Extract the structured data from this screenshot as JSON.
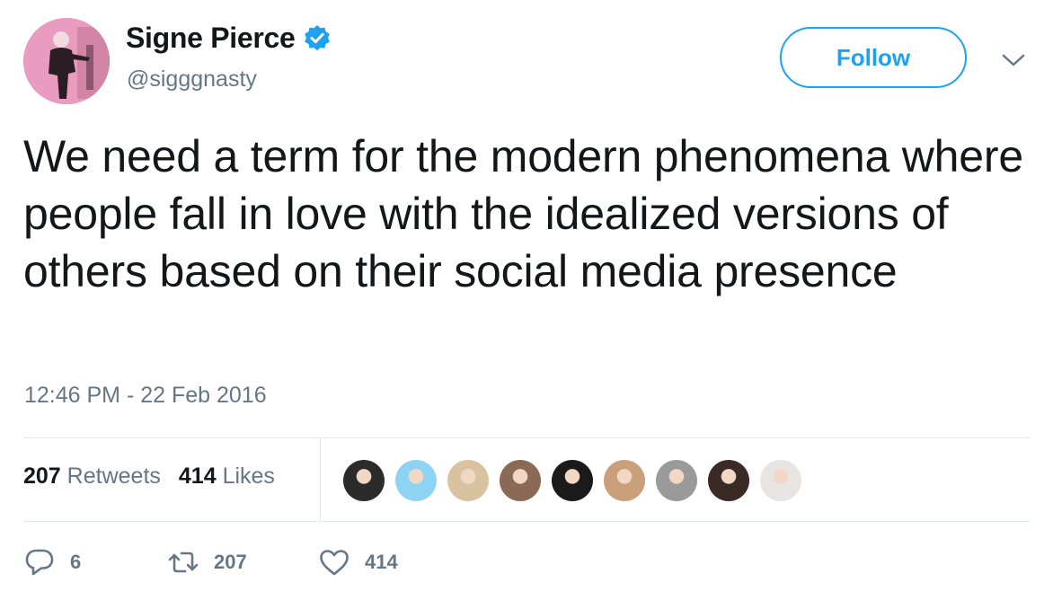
{
  "author": {
    "display_name": "Signe Pierce",
    "handle": "@sigggnasty",
    "verified": true
  },
  "header": {
    "follow_label": "Follow"
  },
  "tweet": {
    "text": "We need a term for the modern phenomena where people fall in love with the idealized versions of others based on their social media presence",
    "timestamp": "12:46 PM - 22 Feb 2016"
  },
  "stats": {
    "retweets_count": "207",
    "retweets_label": "Retweets",
    "likes_count": "414",
    "likes_label": "Likes"
  },
  "likers": [
    {
      "name": "liker-avatar-1",
      "color": "#2b2b2b"
    },
    {
      "name": "liker-avatar-2",
      "color": "#8fd3f4"
    },
    {
      "name": "liker-avatar-3",
      "color": "#d9c2a0"
    },
    {
      "name": "liker-avatar-4",
      "color": "#8a6a55"
    },
    {
      "name": "liker-avatar-5",
      "color": "#1a1a1a"
    },
    {
      "name": "liker-avatar-6",
      "color": "#c9a07a"
    },
    {
      "name": "liker-avatar-7",
      "color": "#9a9a9a"
    },
    {
      "name": "liker-avatar-8",
      "color": "#3a2a25"
    },
    {
      "name": "liker-avatar-9",
      "color": "#e8e4e2"
    }
  ],
  "actions": {
    "reply_count": "6",
    "retweet_count": "207",
    "like_count": "414"
  },
  "colors": {
    "accent": "#1da1f2",
    "text": "#14171a",
    "muted": "#657786",
    "divider": "#e1e8ed"
  }
}
